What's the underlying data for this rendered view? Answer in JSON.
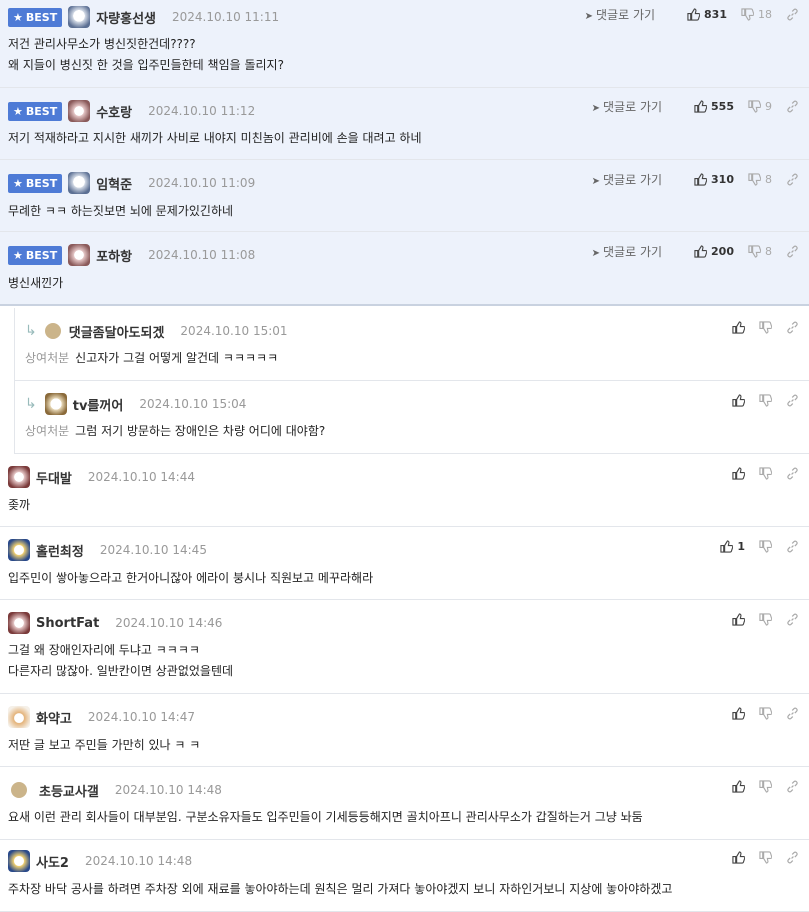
{
  "best_label": "BEST",
  "goto_label": "댓글로 가기",
  "comments": [
    {
      "best": true,
      "nick": "자량홍선생",
      "date": "2024.10.10 11:11",
      "lines": [
        "저건 관리사무소가 병신짓한건데????",
        "왜 지들이 병신짓 한 것을 입주민들한테 책임을 돌리지?"
      ],
      "likes": "831",
      "dislikes": "18"
    },
    {
      "best": true,
      "nick": "수호랑",
      "date": "2024.10.10 11:12",
      "lines": [
        "저기 적재하라고 지시한 새끼가 사비로 내야지 미친놈이 관리비에 손을 대려고 하네"
      ],
      "likes": "555",
      "dislikes": "9"
    },
    {
      "best": true,
      "nick": "임혁준",
      "date": "2024.10.10 11:09",
      "lines": [
        "무례한 ㅋㅋ 하는짓보면 뇌에 문제가있긴하네"
      ],
      "likes": "310",
      "dislikes": "8"
    },
    {
      "best": true,
      "nick": "포하항",
      "date": "2024.10.10 11:08",
      "lines": [
        "병신새낀가"
      ],
      "likes": "200",
      "dislikes": "8"
    },
    {
      "reply": true,
      "nick": "댓글좀달아도되겠",
      "date": "2024.10.10 15:01",
      "tag": "상여처분",
      "lines": [
        "신고자가 그걸 어떻게 알건데 ㅋㅋㅋㅋㅋ"
      ],
      "likes": "",
      "dislikes": ""
    },
    {
      "reply": true,
      "nick": "tv를꺼어",
      "date": "2024.10.10 15:04",
      "tag": "상여처분",
      "lines": [
        "그럼 저기 방문하는 장애인은 차량 어디에 대야함?"
      ],
      "likes": "",
      "dislikes": ""
    },
    {
      "nick": "두대발",
      "date": "2024.10.10 14:44",
      "lines": [
        "좆까"
      ],
      "likes": "",
      "dislikes": ""
    },
    {
      "nick": "홀런최정",
      "date": "2024.10.10 14:45",
      "lines": [
        "입주민이 쌓아놓으라고 한거아니잖아 에라이 붕시나 직원보고 메꾸라해라"
      ],
      "likes": "1",
      "dislikes": ""
    },
    {
      "nick": "ShortFat",
      "date": "2024.10.10 14:46",
      "lines": [
        "그걸 왜 장애인자리에 두냐고 ㅋㅋㅋㅋ",
        "다른자리 많잖아. 일반칸이면 상관없었을텐데"
      ],
      "likes": "",
      "dislikes": ""
    },
    {
      "nick": "화약고",
      "date": "2024.10.10 14:47",
      "lines": [
        "저딴 글 보고 주민들 가만히 있나 ㅋ ㅋ"
      ],
      "likes": "",
      "dislikes": ""
    },
    {
      "nick": "초등교사갤",
      "date": "2024.10.10 14:48",
      "lines": [
        "요새 이런 관리 회사들이 대부분임. 구분소유자들도 입주민들이 기세등등해지면 골치아프니 관리사무소가 갑질하는거 그냥 놔둠"
      ],
      "likes": "",
      "dislikes": ""
    },
    {
      "nick": "사도2",
      "date": "2024.10.10 14:48",
      "lines": [
        "주차장 바닥 공사를 하려면 주차장 외에 재료를 놓아야하는데 원칙은 멀리 가져다 놓아야겠지 보니 자하인거보니 지상에 놓아야하겠고"
      ],
      "likes": "",
      "dislikes": ""
    }
  ],
  "colors": {
    "best_bg": "#edf2fb",
    "badge": "#4e7bd6",
    "border": "#e3e6eb"
  },
  "icons": [
    "star-icon",
    "send-arrow-icon",
    "thumbs-up-icon",
    "thumbs-down-icon",
    "link-icon",
    "reply-arrow-icon"
  ]
}
